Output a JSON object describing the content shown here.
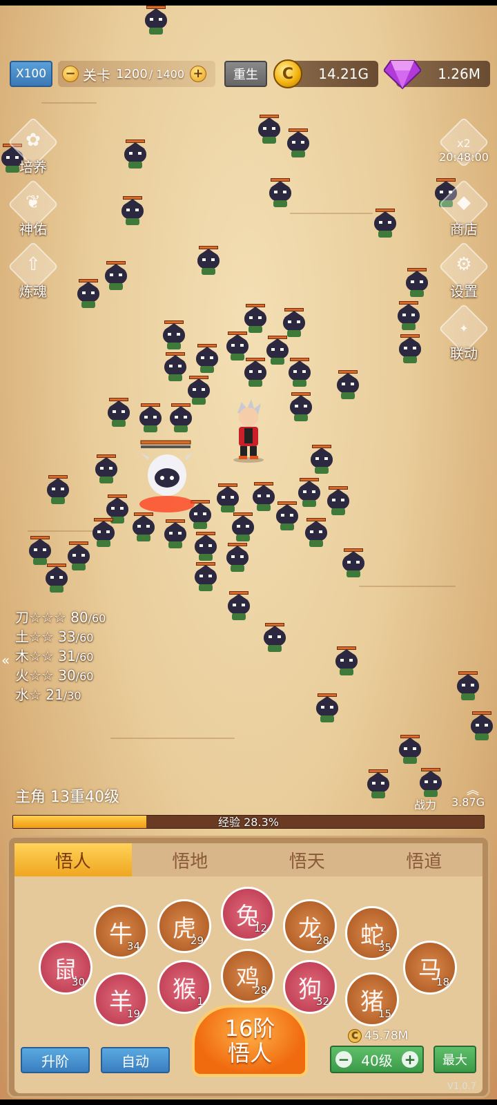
{
  "topbar": {
    "speed_label": "X100",
    "stage_label": "关卡",
    "stage_current": "1200",
    "stage_max": "/ 1400",
    "minus": "−",
    "plus": "+",
    "rebirth_label": "重生",
    "gold_value": "14.21G",
    "gem_value": "1.26M",
    "coin_glyph": "C"
  },
  "left_menu": [
    {
      "label": "培养",
      "icon": "cultivate-icon"
    },
    {
      "label": "神佑",
      "icon": "blessing-icon"
    },
    {
      "label": "炼魂",
      "icon": "soul-refine-icon"
    }
  ],
  "right_menu": {
    "double": {
      "badge": "x2",
      "timer": "20:48:00",
      "icon": "money-bag-icon"
    },
    "shop": {
      "label": "商店",
      "icon": "gem-icon"
    },
    "settings": {
      "label": "设置",
      "icon": "gear-icon"
    },
    "collab": {
      "label": "联动",
      "icon": "collab-icon"
    }
  },
  "element_stats": [
    {
      "name": "刀☆☆☆",
      "cur": "80",
      "max": "/60"
    },
    {
      "name": "土☆☆",
      "cur": "33",
      "max": "/60"
    },
    {
      "name": "木☆☆",
      "cur": "31",
      "max": "/60"
    },
    {
      "name": "火☆☆",
      "cur": "30",
      "max": "/60"
    },
    {
      "name": "水☆",
      "cur": "21",
      "max": "/30"
    }
  ],
  "collapse_arrow": "«",
  "hero": {
    "level_text": "主角 13重40级",
    "power_label": "战力",
    "power_value": "3.87G",
    "exp_text": "经验 28.3%",
    "exp_fraction": 0.283
  },
  "tabs": [
    "悟人",
    "悟地",
    "悟天",
    "悟道"
  ],
  "zodiac": [
    {
      "animal": "rat",
      "glyph": "鼠",
      "level": "30",
      "color": "red"
    },
    {
      "animal": "ox",
      "glyph": "牛",
      "level": "34",
      "color": "brown"
    },
    {
      "animal": "tiger",
      "glyph": "虎",
      "level": "29",
      "color": "brown"
    },
    {
      "animal": "rabbit",
      "glyph": "兔",
      "level": "12",
      "color": "red"
    },
    {
      "animal": "dragon",
      "glyph": "龙",
      "level": "28",
      "color": "brown"
    },
    {
      "animal": "snake",
      "glyph": "蛇",
      "level": "35",
      "color": "brown"
    },
    {
      "animal": "horse",
      "glyph": "马",
      "level": "18",
      "color": "brown"
    },
    {
      "animal": "goat",
      "glyph": "羊",
      "level": "19",
      "color": "red"
    },
    {
      "animal": "monkey",
      "glyph": "猴",
      "level": "1",
      "color": "red"
    },
    {
      "animal": "rooster",
      "glyph": "鸡",
      "level": "28",
      "color": "brown"
    },
    {
      "animal": "dog",
      "glyph": "狗",
      "level": "32",
      "color": "red"
    },
    {
      "animal": "pig",
      "glyph": "猪",
      "level": "15",
      "color": "brown"
    }
  ],
  "actions": {
    "advance_label": "升阶",
    "auto_label": "自动",
    "main_line1": "16阶",
    "main_line2": "悟人",
    "cost": "45.78M",
    "level_label": "40级",
    "max_label": "最大",
    "coin_glyph": "C"
  },
  "version": "V1.0.7",
  "colors": {
    "sand": "#e9cd9b",
    "accent_blue": "#3a7ec0",
    "accent_green": "#3b9a48",
    "accent_orange": "#f06a0e",
    "monster_body": "#2c2840"
  }
}
